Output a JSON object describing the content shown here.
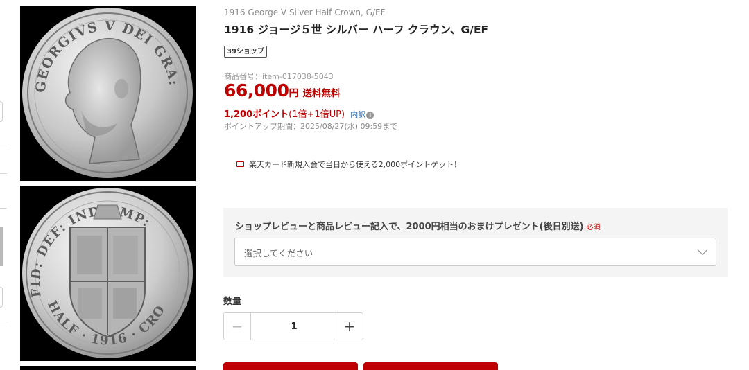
{
  "product": {
    "title_en": "1916 George V Silver Half Crown, G/EF",
    "title_jp": "1916 ジョージ５世 シルバー ハーフ クラウン、G/EF",
    "shop_badge": "39ショップ",
    "item_number": "商品番号：item-017038-5043"
  },
  "price": {
    "amount": "66,000",
    "unit": "円",
    "shipping": "送料無料"
  },
  "points": {
    "amount": "1,200ポイント",
    "detail": "(1倍+1倍UP)",
    "breakdown_link": "内訳",
    "info_icon": "i",
    "period": "ポイントアップ期間：2025/08/27(水) 09:59まで"
  },
  "promo": {
    "icon": "credit-card-icon",
    "text": "楽天カード新規入会で当日から使える2,000ポイントゲット！"
  },
  "option": {
    "label": "ショップレビューと商品レビュー記入で、2000円相当のおまけプレゼント(後日別送)",
    "required": "必須",
    "placeholder": "選択してください"
  },
  "quantity": {
    "label": "数量",
    "value": "1",
    "minus": "−",
    "plus": "+"
  },
  "colors": {
    "accent": "#bf0000",
    "link": "#1a5fb4",
    "panel": "#f4f4f4"
  }
}
